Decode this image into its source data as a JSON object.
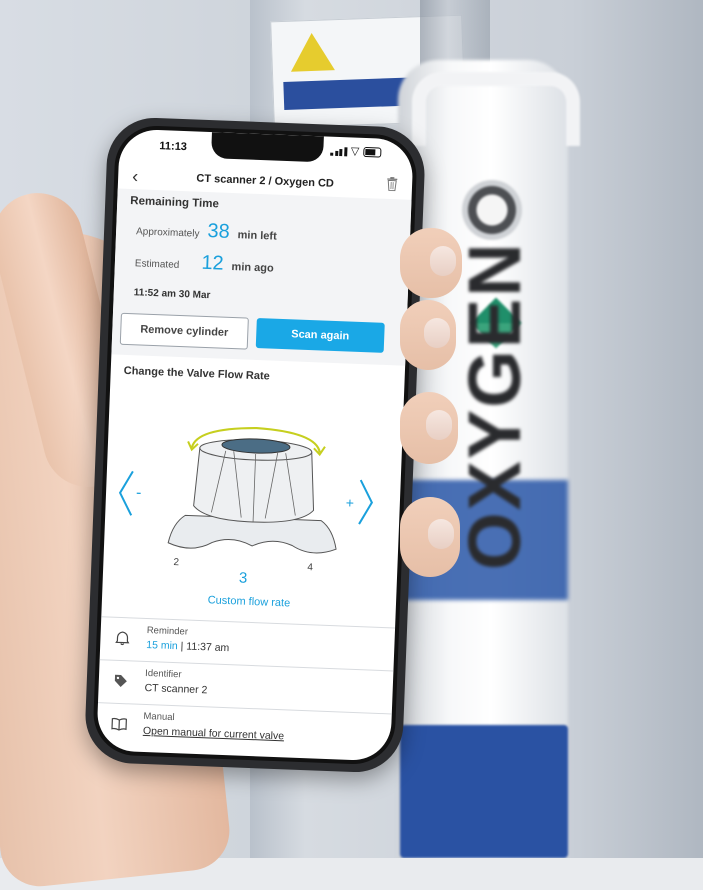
{
  "status_bar": {
    "time": "11:13"
  },
  "nav": {
    "title": "CT scanner 2 / Oxygen CD",
    "back_icon": "chevron-left-icon",
    "trash_icon": "trash-icon"
  },
  "remaining": {
    "heading": "Remaining Time",
    "approx_label": "Approximately",
    "approx_value": "38",
    "approx_unit": "min left",
    "est_label": "Estimated",
    "est_value": "12",
    "est_unit": "min ago",
    "timestamp": "11:52 am 30 Mar"
  },
  "buttons": {
    "remove": "Remove cylinder",
    "scan": "Scan again"
  },
  "valve": {
    "heading": "Change the Valve Flow Rate",
    "decrease": "-",
    "increase": "+",
    "left_value": "2",
    "current_value": "3",
    "right_value": "4",
    "custom_label": "Custom flow rate"
  },
  "details": [
    {
      "icon": "bell-icon",
      "label": "Reminder",
      "value_highlight": "15 min",
      "value_rest": " | 11:37 am"
    },
    {
      "icon": "tag-icon",
      "label": "Identifier",
      "value": "CT scanner 2"
    },
    {
      "icon": "book-icon",
      "label": "Manual",
      "value": "Open manual for current valve"
    }
  ],
  "background": {
    "cylinder_text": "OXYGEN"
  },
  "colors": {
    "accent": "#1aa0dc",
    "button_primary": "#1aa8e6",
    "panel_bg": "#f3f4f6"
  }
}
